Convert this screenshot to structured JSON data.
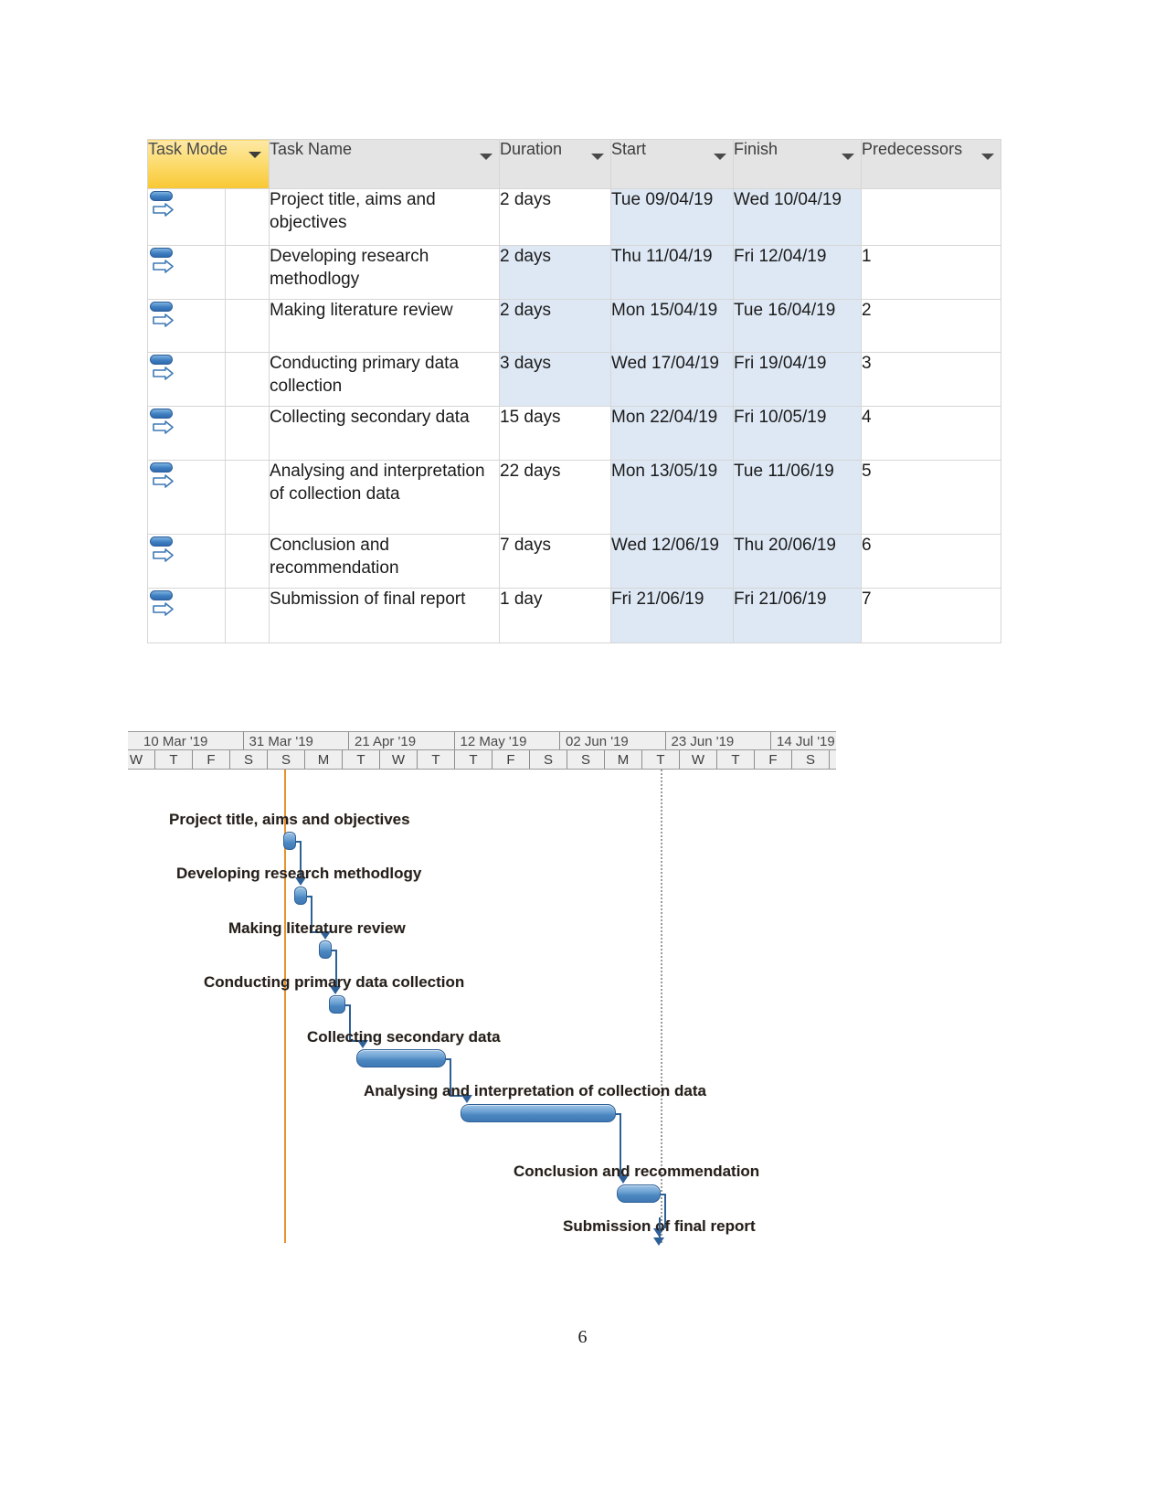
{
  "table": {
    "columns": [
      {
        "label": "Task Mode",
        "highlight": true
      },
      {
        "label": "Task Name",
        "highlight": false
      },
      {
        "label": "Duration",
        "highlight": false
      },
      {
        "label": "Start",
        "highlight": false
      },
      {
        "label": "Finish",
        "highlight": false
      },
      {
        "label": "Predecessors",
        "highlight": false
      }
    ],
    "rows": [
      {
        "mode_icon": "manually-scheduled-icon",
        "name": "Project title, aims and objectives",
        "duration": "2 days",
        "start": "Tue 09/04/19",
        "finish": "Wed 10/04/19",
        "predecessors": ""
      },
      {
        "mode_icon": "manually-scheduled-icon",
        "name": "Developing research methodlogy",
        "duration": "2 days",
        "start": "Thu 11/04/19",
        "finish": "Fri 12/04/19",
        "predecessors": "1"
      },
      {
        "mode_icon": "manually-scheduled-icon",
        "name": "Making literature review",
        "duration": "2 days",
        "start": "Mon 15/04/19",
        "finish": "Tue 16/04/19",
        "predecessors": "2"
      },
      {
        "mode_icon": "manually-scheduled-icon",
        "name": "Conducting primary data collection",
        "duration": "3 days",
        "start": "Wed 17/04/19",
        "finish": "Fri 19/04/19",
        "predecessors": "3"
      },
      {
        "mode_icon": "manually-scheduled-icon",
        "name": "Collecting secondary data",
        "duration": "15 days",
        "start": "Mon 22/04/19",
        "finish": "Fri 10/05/19",
        "predecessors": "4"
      },
      {
        "mode_icon": "manually-scheduled-icon",
        "name": "Analysing and interpretation of collection data",
        "duration": "22 days",
        "start": "Mon 13/05/19",
        "finish": "Tue 11/06/19",
        "predecessors": "5"
      },
      {
        "mode_icon": "manually-scheduled-icon",
        "name": "Conclusion and recommendation",
        "duration": "7 days",
        "start": "Wed 12/06/19",
        "finish": "Thu 20/06/19",
        "predecessors": "6"
      },
      {
        "mode_icon": "manually-scheduled-icon",
        "name": "Submission of final report",
        "duration": "1 day",
        "start": "Fri 21/06/19",
        "finish": "Fri 21/06/19",
        "predecessors": "7"
      }
    ]
  },
  "chart_data": {
    "type": "gantt",
    "title": "Project schedule Gantt chart",
    "timescale": {
      "major_unit": "three-week period",
      "major_ticks": [
        "10 Mar '19",
        "31 Mar '19",
        "21 Apr '19",
        "12 May '19",
        "02 Jun '19",
        "23 Jun '19",
        "14 Jul '19"
      ],
      "minor_unit": "weekday letter",
      "minor_ticks": [
        "W",
        "T",
        "F",
        "S",
        "S",
        "M",
        "T",
        "W",
        "T",
        "T",
        "F",
        "S",
        "S",
        "M",
        "T",
        "W",
        "T",
        "F",
        "S"
      ]
    },
    "markers": [
      {
        "name": "today-line",
        "label": "Today",
        "color": "#e8922c",
        "style": "solid"
      },
      {
        "name": "status-line",
        "label": "Status date",
        "color": "#9b9b9b",
        "style": "dotted"
      }
    ],
    "tasks": [
      {
        "label": "Project title, aims and objectives",
        "duration_days": 2,
        "start": "Tue 09/04/19",
        "finish": "Wed 10/04/19",
        "predecessor": ""
      },
      {
        "label": "Developing research methodlogy",
        "duration_days": 2,
        "start": "Thu 11/04/19",
        "finish": "Fri 12/04/19",
        "predecessor": "1"
      },
      {
        "label": "Making literature review",
        "duration_days": 2,
        "start": "Mon 15/04/19",
        "finish": "Tue 16/04/19",
        "predecessor": "2"
      },
      {
        "label": "Conducting primary data collection",
        "duration_days": 3,
        "start": "Wed 17/04/19",
        "finish": "Fri 19/04/19",
        "predecessor": "3"
      },
      {
        "label": "Collecting secondary data",
        "duration_days": 15,
        "start": "Mon 22/04/19",
        "finish": "Fri 10/05/19",
        "predecessor": "4"
      },
      {
        "label": "Analysing and interpretation of collection data",
        "duration_days": 22,
        "start": "Mon 13/05/19",
        "finish": "Tue 11/06/19",
        "predecessor": "5"
      },
      {
        "label": "Conclusion and recommendation",
        "duration_days": 7,
        "start": "Wed 12/06/19",
        "finish": "Thu 20/06/19",
        "predecessor": "6"
      },
      {
        "label": "Submission of final report",
        "duration_days": 1,
        "start": "Fri 21/06/19",
        "finish": "Fri 21/06/19",
        "predecessor": "7"
      }
    ],
    "bar_color": "#4b86c0",
    "link_color": "#2e6098"
  },
  "footer": {
    "page_number": "6"
  }
}
